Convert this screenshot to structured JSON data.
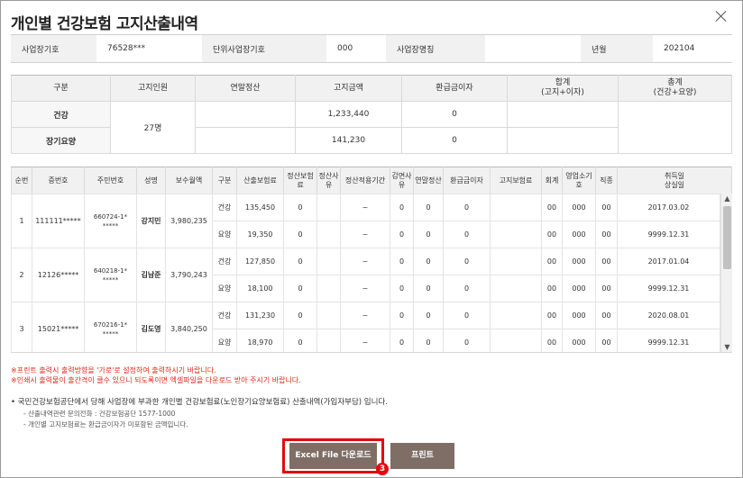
{
  "title": "개인별 건강보험 고지산출내역",
  "info": {
    "biz_no_label": "사업장기호",
    "biz_no": "76528***",
    "unit_no_label": "단위사업장기호",
    "unit_no": "000",
    "biz_name_label": "사업장명칭",
    "biz_name": "",
    "year_month_label": "년월",
    "year_month": "202104"
  },
  "summary": {
    "headers": [
      "구분",
      "고지인원",
      "연말정산",
      "고지금액",
      "환급금이자",
      "합계\n(고지+이자)",
      "총계\n(건강+요양)"
    ],
    "rows": [
      {
        "type": "건강",
        "count": "27명",
        "settle": "",
        "amount": "1,233,440",
        "refund": "0",
        "total": "",
        "grand": ""
      },
      {
        "type": "장기요양",
        "count": "",
        "settle": "",
        "amount": "141,230",
        "refund": "0",
        "total": "",
        "grand": ""
      }
    ]
  },
  "detail": {
    "headers": [
      "순번",
      "증번호",
      "주민번호",
      "성명",
      "보수월액",
      "구분",
      "산출보험료",
      "정산보험료",
      "정산사유",
      "정산적용기간",
      "감면사유",
      "연말정산",
      "환급금이자",
      "고지보험료",
      "회계",
      "영업소기호",
      "직종",
      "취득일\n상실일"
    ],
    "people": [
      {
        "seq": "1",
        "card": "111111*****",
        "rrn": "660724-1*\n*****",
        "name": "강지민",
        "salary": "3,980,235",
        "rows": [
          {
            "kind": "건강",
            "calc": "135,450",
            "settle": "0",
            "reason": "",
            "period": "~",
            "cut": "0",
            "year": "0",
            "refund": "0",
            "notice": "",
            "acct": "00",
            "office": "000",
            "job": "00",
            "date": "2017.03.02"
          },
          {
            "kind": "요양",
            "calc": "19,350",
            "settle": "0",
            "reason": "",
            "period": "~",
            "cut": "0",
            "year": "0",
            "refund": "0",
            "notice": "",
            "acct": "00",
            "office": "000",
            "job": "00",
            "date": "9999.12.31"
          }
        ]
      },
      {
        "seq": "2",
        "card": "12126*****",
        "rrn": "640218-1*\n*****",
        "name": "김남준",
        "salary": "3,790,243",
        "rows": [
          {
            "kind": "건강",
            "calc": "127,850",
            "settle": "0",
            "reason": "",
            "period": "~",
            "cut": "0",
            "year": "0",
            "refund": "0",
            "notice": "",
            "acct": "00",
            "office": "000",
            "job": "00",
            "date": "2017.01.04"
          },
          {
            "kind": "요양",
            "calc": "18,100",
            "settle": "0",
            "reason": "",
            "period": "~",
            "cut": "0",
            "year": "0",
            "refund": "0",
            "notice": "",
            "acct": "00",
            "office": "000",
            "job": "00",
            "date": "9999.12.31"
          }
        ]
      },
      {
        "seq": "3",
        "card": "15021*****",
        "rrn": "670216-1*\n*****",
        "name": "김도영",
        "salary": "3,840,250",
        "rows": [
          {
            "kind": "건강",
            "calc": "131,230",
            "settle": "0",
            "reason": "",
            "period": "~",
            "cut": "0",
            "year": "0",
            "refund": "0",
            "notice": "",
            "acct": "00",
            "office": "000",
            "job": "00",
            "date": "2020.08.01"
          },
          {
            "kind": "요양",
            "calc": "18,970",
            "settle": "0",
            "reason": "",
            "period": "~",
            "cut": "0",
            "year": "0",
            "refund": "0",
            "notice": "",
            "acct": "00",
            "office": "000",
            "job": "00",
            "date": "9999.12.31"
          }
        ]
      }
    ]
  },
  "notices": {
    "red1": "※프린트 출력시 출력방향을 '가로'로 설정하여 출력하시기 바랍니다.",
    "red2": "※인쇄시 출력물이 출간격이 클수 있으니 되도록이면 엑셀파일을 다운로드 받아 주시기 바랍니다.",
    "main": "• 국민건강보험공단에서 당해 사업장에 부과한 개인별 건강보험료(노인장기요양보험료) 산출내역(가입자부담) 입니다.",
    "sub1": "- 산출내역관련 문의전화 : 건강보험공단 1577-1000",
    "sub2": "- 개인별 고지보험료는 환급금이자가 미포함된 금액입니다."
  },
  "buttons": {
    "excel": "Excel File 다운로드",
    "print": "프린트"
  },
  "step_badge": "3",
  "colors": {
    "button_bg": "#7e6e66",
    "highlight": "#e3080f",
    "notice_red": "#e0261b"
  }
}
